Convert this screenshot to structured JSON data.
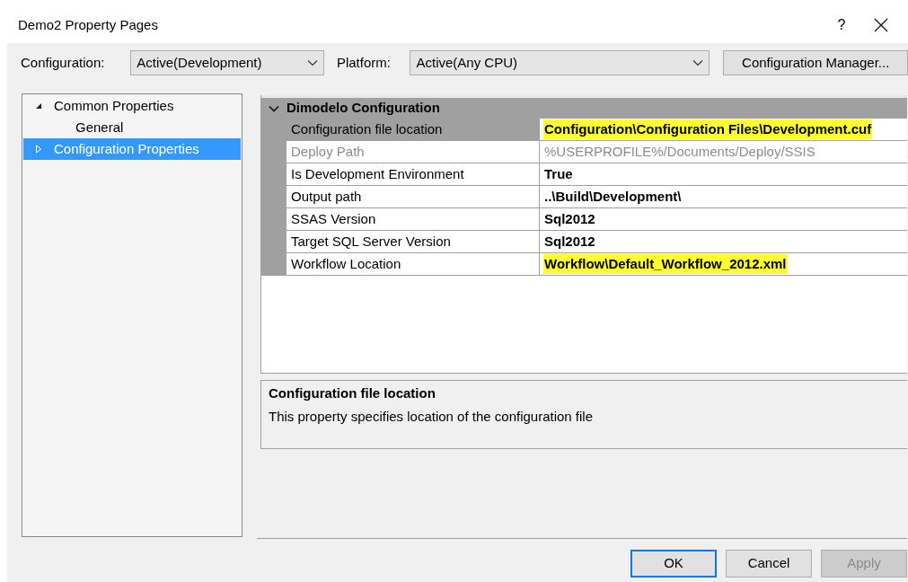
{
  "window": {
    "title": "Demo2 Property Pages",
    "help": "?"
  },
  "toolbar": {
    "configuration_label": "Configuration:",
    "configuration_value": "Active(Development)",
    "platform_label": "Platform:",
    "platform_value": "Active(Any CPU)",
    "manager_button": "Configuration Manager..."
  },
  "tree": [
    {
      "label": "Common Properties",
      "expanded": true,
      "selected": false,
      "children": [
        {
          "label": "General",
          "selected": false
        }
      ]
    },
    {
      "label": "Configuration Properties",
      "expanded": false,
      "selected": true
    }
  ],
  "grid": {
    "category": {
      "label": "Dimodelo Configuration",
      "expanded": true
    },
    "rows": [
      {
        "name": "Configuration file location",
        "value": "Configuration\\Configuration Files\\Development.cuf",
        "selected": true,
        "disabled": false,
        "highlighted": true
      },
      {
        "name": "Deploy Path",
        "value": "%USERPROFILE%/Documents/Deploy/SSIS",
        "selected": false,
        "disabled": true,
        "highlighted": false
      },
      {
        "name": "Is Development Environment",
        "value": "True",
        "selected": false,
        "disabled": false,
        "highlighted": false
      },
      {
        "name": "Output path",
        "value": "..\\Build\\Development\\",
        "selected": false,
        "disabled": false,
        "highlighted": false
      },
      {
        "name": "SSAS Version",
        "value": "Sql2012",
        "selected": false,
        "disabled": false,
        "highlighted": false
      },
      {
        "name": "Target SQL Server Version",
        "value": "Sql2012",
        "selected": false,
        "disabled": false,
        "highlighted": false
      },
      {
        "name": "Workflow Location",
        "value": "Workflow\\Default_Workflow_2012.xml",
        "selected": false,
        "disabled": false,
        "highlighted": true
      }
    ]
  },
  "description": {
    "title": "Configuration file location",
    "text": "This property specifies location of the configuration file"
  },
  "buttons": [
    {
      "label": "OK",
      "default": true,
      "disabled": false
    },
    {
      "label": "Cancel",
      "default": false,
      "disabled": false
    },
    {
      "label": "Apply",
      "default": false,
      "disabled": true
    }
  ]
}
